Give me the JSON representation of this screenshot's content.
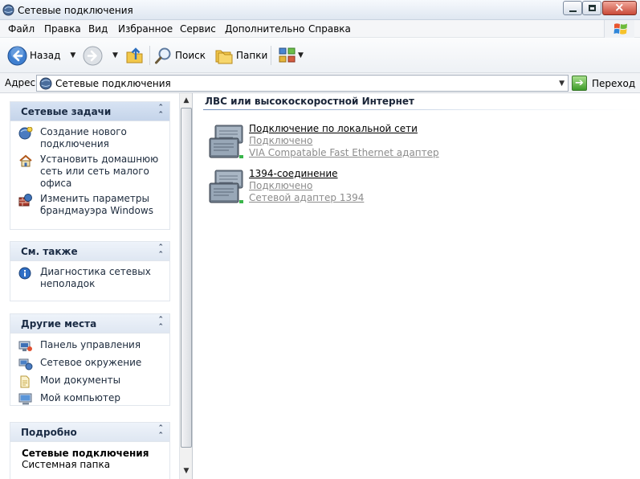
{
  "window": {
    "title": "Сетевые подключения"
  },
  "menu": {
    "items": [
      "Файл",
      "Правка",
      "Вид",
      "Избранное",
      "Сервис",
      "Дополнительно",
      "Справка"
    ]
  },
  "toolbar": {
    "back": "Назад",
    "search": "Поиск",
    "folders": "Папки"
  },
  "address": {
    "label": "Адрес:",
    "value": "Сетевые подключения",
    "go": "Переход"
  },
  "left": {
    "network_tasks": {
      "title": "Сетевые задачи",
      "items": [
        {
          "label": "Создание нового подключения",
          "icon": "new-connection-icon"
        },
        {
          "label": "Установить домашнюю сеть или сеть малого офиса",
          "icon": "home-network-icon"
        },
        {
          "label": "Изменить параметры брандмауэра Windows",
          "icon": "firewall-icon"
        }
      ]
    },
    "see_also": {
      "title": "См. также",
      "items": [
        {
          "label": "Диагностика сетевых неполадок",
          "icon": "info-icon"
        }
      ]
    },
    "other_places": {
      "title": "Другие места",
      "items": [
        {
          "label": "Панель управления",
          "icon": "control-panel-icon"
        },
        {
          "label": "Сетевое окружение",
          "icon": "network-places-icon"
        },
        {
          "label": "Мои документы",
          "icon": "my-documents-icon"
        },
        {
          "label": "Мой компьютер",
          "icon": "my-computer-icon"
        }
      ]
    },
    "details": {
      "title": "Подробно",
      "name": "Сетевые подключения",
      "type": "Системная папка"
    }
  },
  "content": {
    "group_title": "ЛВС или высокоскоростной Интернет",
    "connections": [
      {
        "name": "Подключение по локальной сети",
        "status": "Подключено",
        "device": "VIA Compatable Fast Ethernet адаптер"
      },
      {
        "name": "1394-соединение",
        "status": "Подключено",
        "device": "Сетевой адаптер 1394"
      }
    ]
  },
  "colors": {
    "accent": "#3d6fb5",
    "status_gray": "#8c8c8c",
    "go_green": "#3d9b2a"
  }
}
